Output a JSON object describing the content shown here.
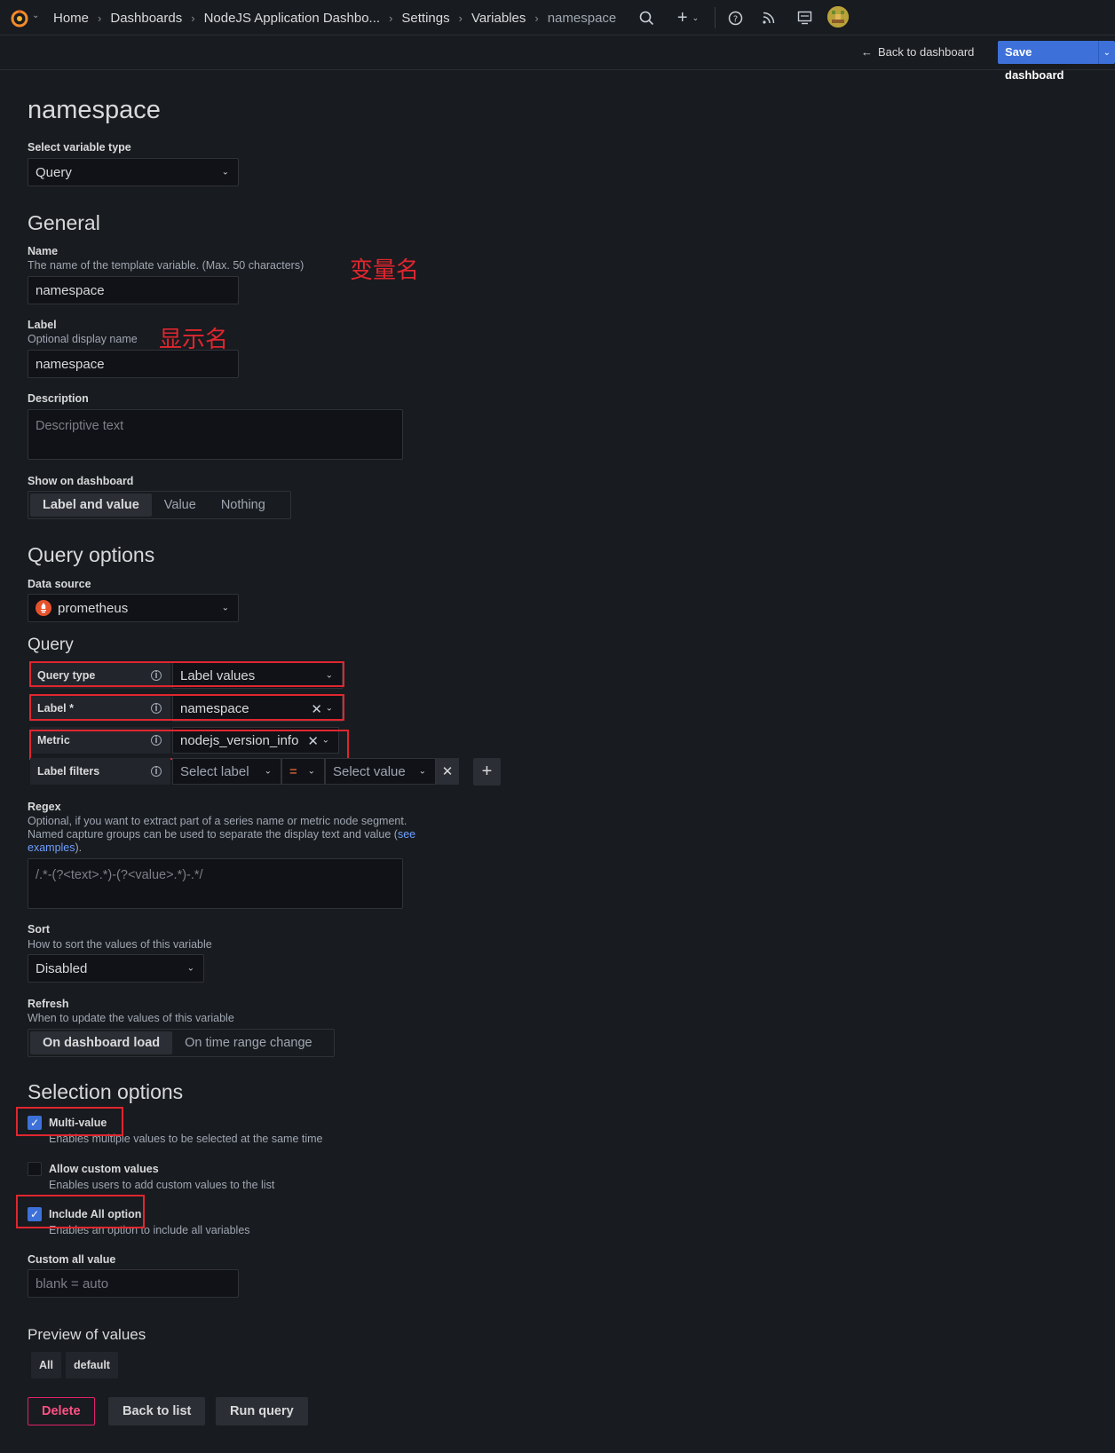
{
  "breadcrumb": [
    "Home",
    "Dashboards",
    "NodeJS Application Dashbo...",
    "Settings",
    "Variables",
    "namespace"
  ],
  "toolbar": {
    "back_to_dashboard": "Back to dashboard",
    "save_dashboard": "Save dashboard"
  },
  "page_title": "namespace",
  "variable_type": {
    "label": "Select variable type",
    "value": "Query"
  },
  "general": {
    "heading": "General",
    "name": {
      "label": "Name",
      "description": "The name of the template variable. (Max. 50 characters)",
      "value": "namespace"
    },
    "label": {
      "label": "Label",
      "description": "Optional display name",
      "value": "namespace"
    },
    "description": {
      "label": "Description",
      "placeholder": "Descriptive text"
    },
    "show_on_dashboard": {
      "label": "Show on dashboard",
      "options": [
        "Label and value",
        "Value",
        "Nothing"
      ],
      "selected": "Label and value"
    }
  },
  "query_options": {
    "heading": "Query options",
    "data_source": {
      "label": "Data source",
      "value": "prometheus"
    },
    "query_heading": "Query",
    "query_type": {
      "label": "Query type",
      "value": "Label values"
    },
    "label_field": {
      "label": "Label *",
      "value": "namespace"
    },
    "metric": {
      "label": "Metric",
      "value": "nodejs_version_info"
    },
    "label_filters": {
      "label": "Label filters",
      "select_label": "Select label",
      "operator": "=",
      "select_value": "Select value"
    },
    "regex": {
      "label": "Regex",
      "description_line1": "Optional, if you want to extract part of a series name or metric node segment.",
      "description_line2": "Named capture groups can be used to separate the display text and value (",
      "link_part1": "see",
      "link_part2": "examples",
      "description_end": ").",
      "placeholder": "/.*-(?<text>.*)-(?<value>.*)-.*/"
    },
    "sort": {
      "label": "Sort",
      "description": "How to sort the values of this variable",
      "value": "Disabled"
    },
    "refresh": {
      "label": "Refresh",
      "description": "When to update the values of this variable",
      "options": [
        "On dashboard load",
        "On time range change"
      ],
      "selected": "On dashboard load"
    }
  },
  "selection_options": {
    "heading": "Selection options",
    "multi_value": {
      "label": "Multi-value",
      "description": "Enables multiple values to be selected at the same time",
      "checked": true
    },
    "allow_custom": {
      "label": "Allow custom values",
      "description": "Enables users to add custom values to the list",
      "checked": false
    },
    "include_all": {
      "label": "Include All option",
      "description": "Enables an option to include all variables",
      "checked": true
    },
    "custom_all": {
      "label": "Custom all value",
      "placeholder": "blank = auto"
    }
  },
  "preview": {
    "heading": "Preview of values",
    "values": [
      "All",
      "default"
    ]
  },
  "actions": {
    "delete": "Delete",
    "back_to_list": "Back to list",
    "run_query": "Run query"
  },
  "annotations": {
    "variable_name": "变量名",
    "display_name": "显示名"
  },
  "colors": {
    "accent": "#3d71d9",
    "annotation": "#e0262f",
    "danger": "#e0226e",
    "background": "#181b1f"
  }
}
